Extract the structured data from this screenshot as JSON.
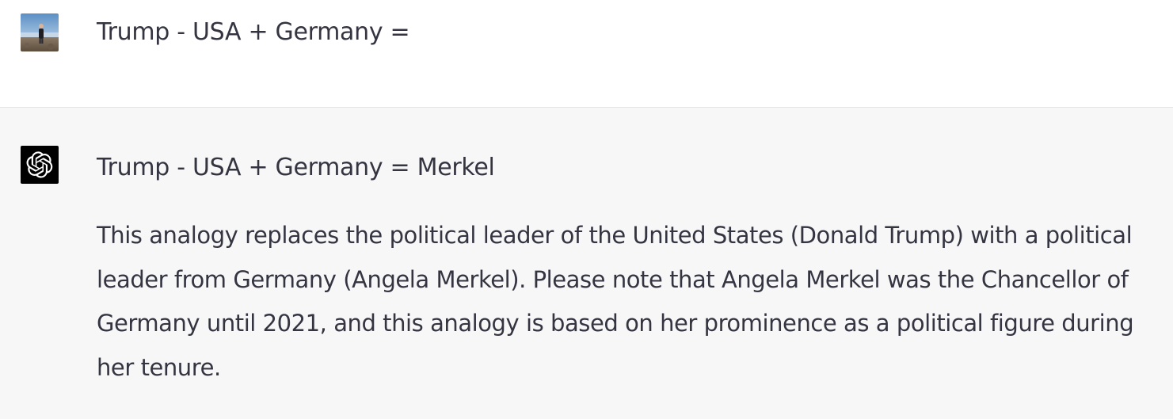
{
  "conversation": {
    "user_message": {
      "text": "Trump - USA + Germany =",
      "avatar_icon": "user-photo-avatar"
    },
    "assistant_message": {
      "avatar_icon": "openai-logo-icon",
      "answer_line": "Trump - USA + Germany = Merkel",
      "explanation": "This analogy replaces the political leader of the United States (Donald Trump) with a political leader from Germany (Angela Merkel). Please note that Angela Merkel was the Chancellor of Germany until 2021, and this analogy is based on her prominence as a political figure during her tenure."
    }
  },
  "colors": {
    "user_bg": "#ffffff",
    "assistant_bg": "#f7f7f8",
    "text": "#343541",
    "assistant_avatar_bg": "#000000"
  }
}
